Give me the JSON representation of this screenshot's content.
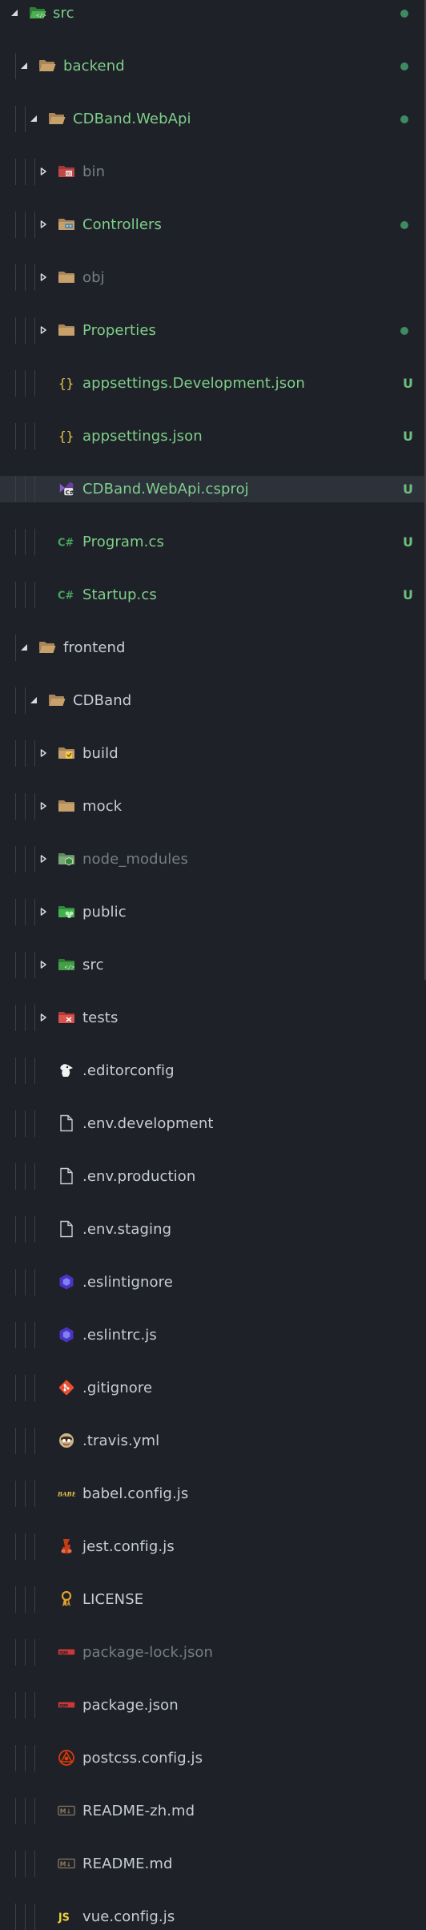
{
  "colors": {
    "background": "#1e2127",
    "selected_row": "#2c313a",
    "added_text": "#7fce8a",
    "default_text": "#c8ccd4",
    "ignored_text": "#767d88",
    "modified_dot": "#3e8a62",
    "untracked_badge": "#6cbf7c"
  },
  "tree": [
    {
      "label": "src",
      "depth": 0,
      "type": "folder",
      "expanded": true,
      "icon": "folder-src-green-icon",
      "text_style": "green",
      "git": "dot"
    },
    {
      "label": "backend",
      "depth": 1,
      "type": "folder",
      "expanded": true,
      "icon": "folder-open-icon",
      "text_style": "green",
      "git": "dot"
    },
    {
      "label": "CDBand.WebApi",
      "depth": 2,
      "type": "folder",
      "expanded": true,
      "icon": "folder-open-icon",
      "text_style": "green",
      "git": "dot"
    },
    {
      "label": "bin",
      "depth": 3,
      "type": "folder",
      "expanded": false,
      "icon": "folder-bin-icon",
      "text_style": "gray",
      "git": ""
    },
    {
      "label": "Controllers",
      "depth": 3,
      "type": "folder",
      "expanded": false,
      "icon": "folder-controllers-icon",
      "text_style": "green",
      "git": "dot"
    },
    {
      "label": "obj",
      "depth": 3,
      "type": "folder",
      "expanded": false,
      "icon": "folder-icon",
      "text_style": "gray",
      "git": ""
    },
    {
      "label": "Properties",
      "depth": 3,
      "type": "folder",
      "expanded": false,
      "icon": "folder-icon",
      "text_style": "green",
      "git": "dot"
    },
    {
      "label": "appsettings.Development.json",
      "depth": 3,
      "type": "file",
      "icon": "json-braces-icon",
      "text_style": "green",
      "git": "U"
    },
    {
      "label": "appsettings.json",
      "depth": 3,
      "type": "file",
      "icon": "json-braces-icon",
      "text_style": "green",
      "git": "U"
    },
    {
      "label": "CDBand.WebApi.csproj",
      "depth": 3,
      "type": "file",
      "icon": "csproj-icon",
      "text_style": "green",
      "git": "U",
      "selected": true
    },
    {
      "label": "Program.cs",
      "depth": 3,
      "type": "file",
      "icon": "csharp-icon",
      "text_style": "green",
      "git": "U"
    },
    {
      "label": "Startup.cs",
      "depth": 3,
      "type": "file",
      "icon": "csharp-icon",
      "text_style": "green",
      "git": "U"
    },
    {
      "label": "frontend",
      "depth": 1,
      "type": "folder",
      "expanded": true,
      "icon": "folder-open-icon",
      "text_style": "white",
      "git": ""
    },
    {
      "label": "CDBand",
      "depth": 2,
      "type": "folder",
      "expanded": true,
      "icon": "folder-open-icon",
      "text_style": "white",
      "git": ""
    },
    {
      "label": "build",
      "depth": 3,
      "type": "folder",
      "expanded": false,
      "icon": "folder-build-icon",
      "text_style": "white",
      "git": ""
    },
    {
      "label": "mock",
      "depth": 3,
      "type": "folder",
      "expanded": false,
      "icon": "folder-icon",
      "text_style": "white",
      "git": ""
    },
    {
      "label": "node_modules",
      "depth": 3,
      "type": "folder",
      "expanded": false,
      "icon": "folder-node-icon",
      "text_style": "gray",
      "git": ""
    },
    {
      "label": "public",
      "depth": 3,
      "type": "folder",
      "expanded": false,
      "icon": "folder-public-icon",
      "text_style": "white",
      "git": ""
    },
    {
      "label": "src",
      "depth": 3,
      "type": "folder",
      "expanded": false,
      "icon": "folder-src-icon",
      "text_style": "white",
      "git": ""
    },
    {
      "label": "tests",
      "depth": 3,
      "type": "folder",
      "expanded": false,
      "icon": "folder-tests-icon",
      "text_style": "white",
      "git": ""
    },
    {
      "label": ".editorconfig",
      "depth": 3,
      "type": "file",
      "icon": "editorconfig-icon",
      "text_style": "white",
      "git": ""
    },
    {
      "label": ".env.development",
      "depth": 3,
      "type": "file",
      "icon": "file-icon",
      "text_style": "white",
      "git": ""
    },
    {
      "label": ".env.production",
      "depth": 3,
      "type": "file",
      "icon": "file-icon",
      "text_style": "white",
      "git": ""
    },
    {
      "label": ".env.staging",
      "depth": 3,
      "type": "file",
      "icon": "file-icon",
      "text_style": "white",
      "git": ""
    },
    {
      "label": ".eslintignore",
      "depth": 3,
      "type": "file",
      "icon": "eslint-icon",
      "text_style": "white",
      "git": ""
    },
    {
      "label": ".eslintrc.js",
      "depth": 3,
      "type": "file",
      "icon": "eslint-icon",
      "text_style": "white",
      "git": ""
    },
    {
      "label": ".gitignore",
      "depth": 3,
      "type": "file",
      "icon": "git-icon",
      "text_style": "white",
      "git": ""
    },
    {
      "label": ".travis.yml",
      "depth": 3,
      "type": "file",
      "icon": "travis-icon",
      "text_style": "white",
      "git": ""
    },
    {
      "label": "babel.config.js",
      "depth": 3,
      "type": "file",
      "icon": "babel-icon",
      "text_style": "white",
      "git": ""
    },
    {
      "label": "jest.config.js",
      "depth": 3,
      "type": "file",
      "icon": "jest-icon",
      "text_style": "white",
      "git": ""
    },
    {
      "label": "LICENSE",
      "depth": 3,
      "type": "file",
      "icon": "license-icon",
      "text_style": "white",
      "git": ""
    },
    {
      "label": "package-lock.json",
      "depth": 3,
      "type": "file",
      "icon": "npm-icon",
      "text_style": "gray",
      "git": ""
    },
    {
      "label": "package.json",
      "depth": 3,
      "type": "file",
      "icon": "npm-icon",
      "text_style": "white",
      "git": ""
    },
    {
      "label": "postcss.config.js",
      "depth": 3,
      "type": "file",
      "icon": "postcss-icon",
      "text_style": "white",
      "git": ""
    },
    {
      "label": "README-zh.md",
      "depth": 3,
      "type": "file",
      "icon": "markdown-icon",
      "text_style": "white",
      "git": ""
    },
    {
      "label": "README.md",
      "depth": 3,
      "type": "file",
      "icon": "markdown-icon",
      "text_style": "white",
      "git": ""
    },
    {
      "label": "vue.config.js",
      "depth": 3,
      "type": "file",
      "icon": "js-icon",
      "text_style": "white",
      "git": ""
    }
  ]
}
